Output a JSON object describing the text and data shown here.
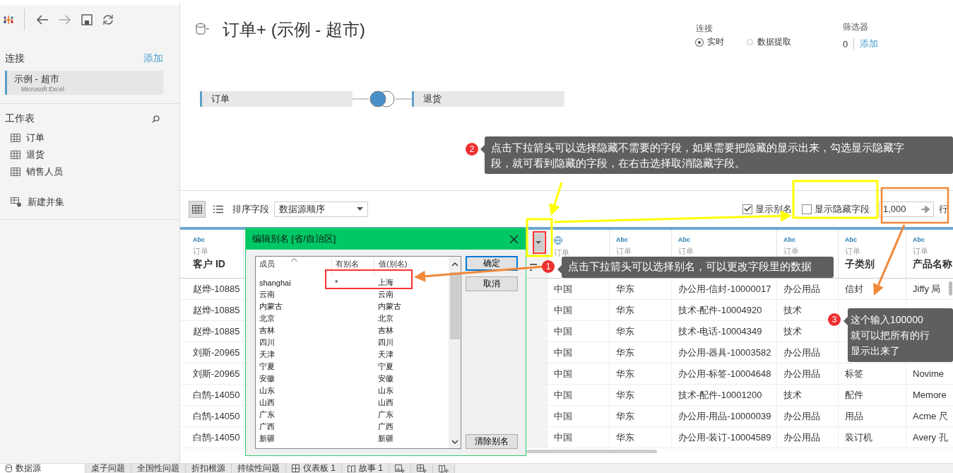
{
  "sidebar": {
    "connections_label": "连接",
    "add_link": "添加",
    "connection": {
      "name": "示例 - 超市",
      "type": "Microsoft Excel",
      "selected": true
    },
    "sheets_label": "工作表",
    "sheets": [
      {
        "name": "订单"
      },
      {
        "name": "退货"
      },
      {
        "name": "销售人员"
      }
    ],
    "new_union": "新建并集"
  },
  "header": {
    "title": "订单+ (示例 - 超市)",
    "connection": {
      "label": "连接",
      "options": [
        {
          "label": "实时",
          "selected": true
        },
        {
          "label": "数据提取",
          "selected": false
        }
      ]
    },
    "filters": {
      "label": "筛选器",
      "count": "0",
      "add_link": "添加"
    },
    "join": {
      "left": "订单",
      "right": "退货"
    }
  },
  "toolbar": {
    "views": [
      {
        "kind": "grid",
        "selected": true
      },
      {
        "kind": "list",
        "selected": false
      }
    ],
    "sort_label": "排序字段",
    "sort_value": "数据源顺序",
    "show_aliases": {
      "label": "显示别名",
      "checked": true
    },
    "show_hidden": {
      "label": "显示隐藏字段",
      "checked": false
    },
    "row_count": "1,000",
    "rows_label": "行"
  },
  "table": {
    "columns": [
      {
        "kind": "text",
        "type": "Abc",
        "source": "订单",
        "name": "客户 ID"
      },
      {
        "kind": "geo",
        "source": "订单"
      },
      {
        "kind": "text",
        "type": "Abc",
        "source": "订单"
      },
      {
        "kind": "text",
        "type": "Abc",
        "source": "订单"
      },
      {
        "kind": "text",
        "type": "Abc",
        "source": "订单"
      },
      {
        "kind": "text",
        "type": "Abc",
        "source": "订单",
        "name": "子类别"
      },
      {
        "kind": "text",
        "type": "Abc",
        "source": "订单",
        "name": "产品名称"
      }
    ],
    "rows": [
      {
        "cells": [
          "赵烨-10885",
          "中国",
          "华东",
          "办公用-信封-10000017",
          "办公用品",
          "信封",
          "Jiffy 局"
        ]
      },
      {
        "cells": [
          "赵烨-10885",
          "中国",
          "华东",
          "技术-配件-10004920",
          "技术"
        ]
      },
      {
        "cells": [
          "赵烨-10885",
          "中国",
          "华东",
          "技术-电话-10004349",
          "技术"
        ]
      },
      {
        "cells": [
          "刘斯-20965",
          "中国",
          "华东",
          "办公用-器具-10003582",
          "办公用品"
        ]
      },
      {
        "cells": [
          "刘斯-20965",
          "中国",
          "华东",
          "办公用-标签-10004648",
          "办公用品",
          "标签",
          "Novime"
        ]
      },
      {
        "cells": [
          "白鹄-14050",
          "中国",
          "华东",
          "技术-配件-10001200",
          "技术",
          "配件",
          "Memore"
        ]
      },
      {
        "cells": [
          "白鹄-14050",
          "中国",
          "华东",
          "办公用-用品-10000039",
          "办公用品",
          "用品",
          "Acme 尺"
        ]
      },
      {
        "cells": [
          "白鹄-14050",
          "中国",
          "华东",
          "办公用-装订-10004589",
          "办公用品",
          "装订机",
          "Avery 孔"
        ]
      }
    ]
  },
  "dialog": {
    "title": "编辑别名 [省/自治区]",
    "columns": [
      "成员",
      "有别名",
      "值(别名)"
    ],
    "members": [
      {
        "member": "shanghai",
        "has_alias": "*",
        "alias": "上海"
      },
      {
        "member": "云南",
        "alias": "云南"
      },
      {
        "member": "内蒙古",
        "alias": "内蒙古"
      },
      {
        "member": "北京",
        "alias": "北京"
      },
      {
        "member": "吉林",
        "alias": "吉林"
      },
      {
        "member": "四川",
        "alias": "四川"
      },
      {
        "member": "天津",
        "alias": "天津"
      },
      {
        "member": "宁夏",
        "alias": "宁夏"
      },
      {
        "member": "安徽",
        "alias": "安徽"
      },
      {
        "member": "山东",
        "alias": "山东"
      },
      {
        "member": "山西",
        "alias": "山西"
      },
      {
        "member": "广东",
        "alias": "广东"
      },
      {
        "member": "广西",
        "alias": "广西"
      },
      {
        "member": "新疆",
        "alias": "新疆"
      }
    ],
    "buttons": [
      {
        "label": "确定",
        "focused": true
      },
      {
        "label": "取消",
        "focused": false
      },
      {
        "label": "清除别名",
        "focused": false
      }
    ]
  },
  "annotations": [
    {
      "number": "2",
      "lines": [
        "点击下拉箭头可以选择隐藏不需要的字段，如果需要把隐藏的显示出来，勾选显示隐藏字",
        "段，就可看到隐藏的字段，在右击选择取消隐藏字段。"
      ]
    },
    {
      "number": "1",
      "lines": [
        "点击下拉箭头可以选择别名，可以更改字段里的数据"
      ]
    },
    {
      "number": "3",
      "lines": [
        "这个输入100000",
        "就可以把所有的行",
        "显示出来了"
      ]
    }
  ],
  "bottom_tabs": [
    {
      "label": "数据源",
      "kind": "datasource",
      "selected": true
    },
    {
      "label": "桌子问题",
      "kind": "sheet",
      "selected": false
    },
    {
      "label": "全国性问题",
      "kind": "sheet",
      "selected": false
    },
    {
      "label": "折扣根源",
      "kind": "sheet",
      "selected": false
    },
    {
      "label": "持续性问题",
      "kind": "sheet",
      "selected": false
    },
    {
      "label": "仪表板 1",
      "kind": "dashboard",
      "selected": false
    },
    {
      "label": "故事 1",
      "kind": "story",
      "selected": false
    }
  ]
}
